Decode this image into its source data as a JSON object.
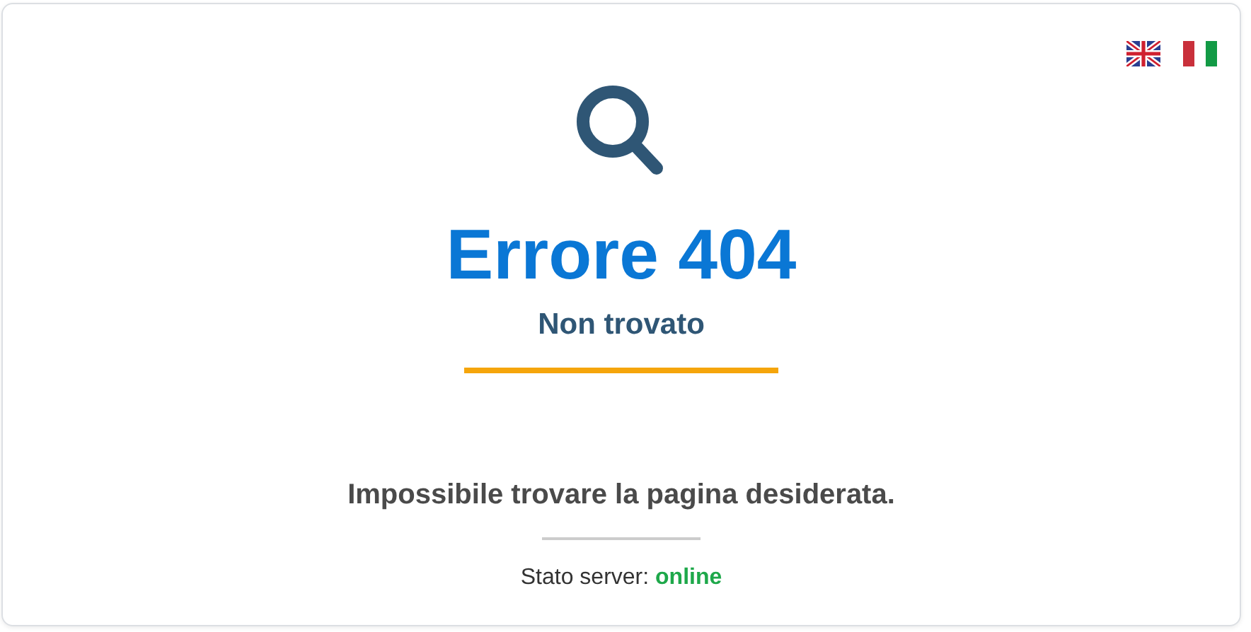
{
  "languages": [
    {
      "kind": "uk"
    },
    {
      "kind": "it"
    }
  ],
  "error": {
    "title": "Errore 404",
    "subtitle": "Non trovato",
    "message": "Impossibile trovare la pagina desiderata."
  },
  "server_status": {
    "label": "Stato server:",
    "value": "online",
    "online": true
  }
}
